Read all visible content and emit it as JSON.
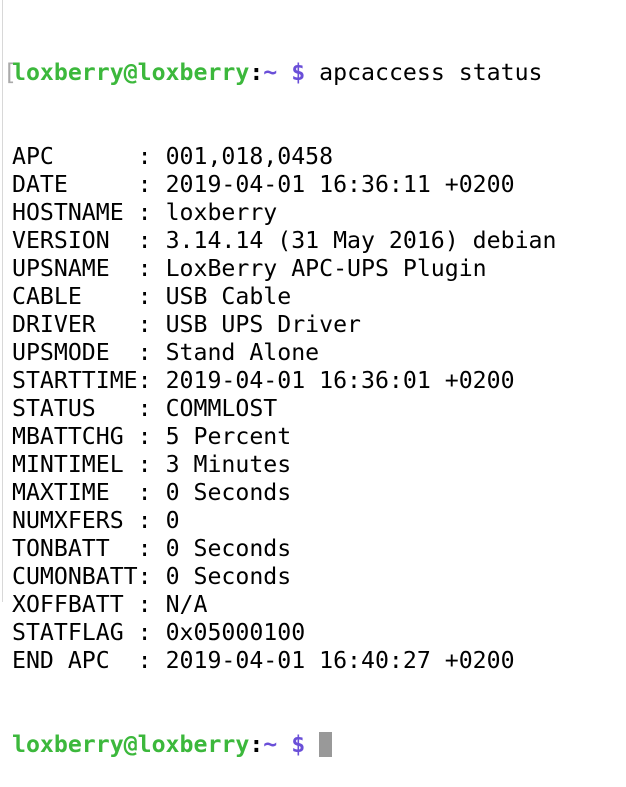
{
  "prompt": {
    "user_host": "loxberry@loxberry",
    "colon": ":",
    "path": "~ $",
    "bracket": "["
  },
  "command": "apcaccess status",
  "output": [
    {
      "key": "APC      ",
      "value": "001,018,0458"
    },
    {
      "key": "DATE     ",
      "value": "2019-04-01 16:36:11 +0200"
    },
    {
      "key": "HOSTNAME ",
      "value": "loxberry"
    },
    {
      "key": "VERSION  ",
      "value": "3.14.14 (31 May 2016) debian"
    },
    {
      "key": "UPSNAME  ",
      "value": "LoxBerry APC-UPS Plugin"
    },
    {
      "key": "CABLE    ",
      "value": "USB Cable"
    },
    {
      "key": "DRIVER   ",
      "value": "USB UPS Driver"
    },
    {
      "key": "UPSMODE  ",
      "value": "Stand Alone"
    },
    {
      "key": "STARTTIME",
      "value": "2019-04-01 16:36:01 +0200"
    },
    {
      "key": "STATUS   ",
      "value": "COMMLOST"
    },
    {
      "key": "MBATTCHG ",
      "value": "5 Percent"
    },
    {
      "key": "MINTIMEL ",
      "value": "3 Minutes"
    },
    {
      "key": "MAXTIME  ",
      "value": "0 Seconds"
    },
    {
      "key": "NUMXFERS ",
      "value": "0"
    },
    {
      "key": "TONBATT  ",
      "value": "0 Seconds"
    },
    {
      "key": "CUMONBATT",
      "value": "0 Seconds"
    },
    {
      "key": "XOFFBATT ",
      "value": "N/A"
    },
    {
      "key": "STATFLAG ",
      "value": "0x05000100"
    },
    {
      "key": "END APC  ",
      "value": "2019-04-01 16:40:27 +0200"
    }
  ],
  "separator": ": "
}
